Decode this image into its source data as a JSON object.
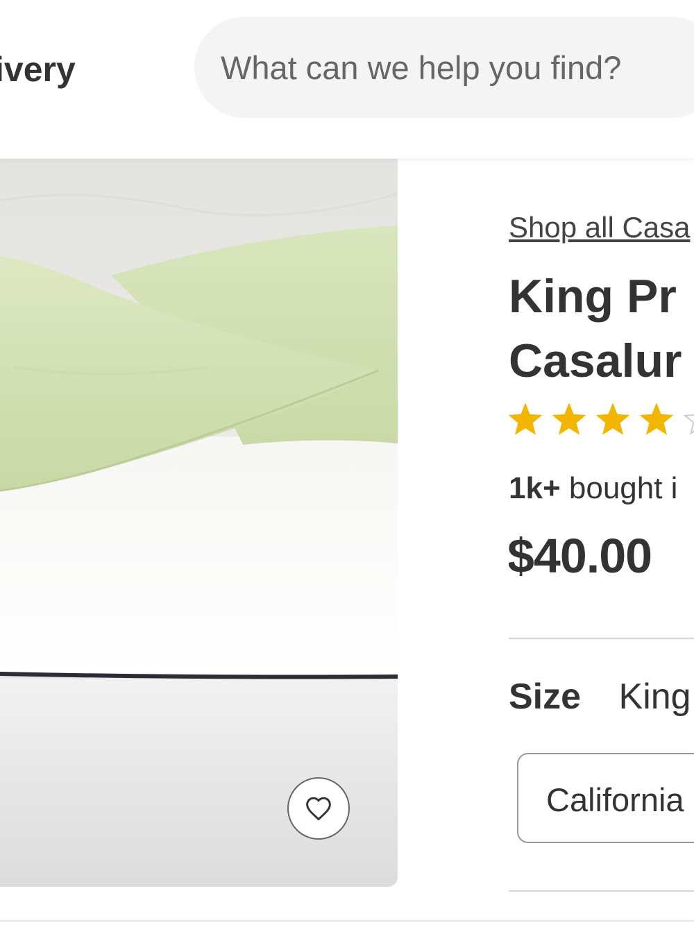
{
  "header": {
    "delivery_label": "ivery",
    "search": {
      "placeholder": "What can we help you find?"
    }
  },
  "product": {
    "image": {
      "description_icon": "pillows-on-bed-image",
      "favorite_icon": "heart-icon"
    },
    "shop_all_link": "Shop all Casa",
    "title_lines": [
      "King Pr",
      "Casalur"
    ],
    "rating": {
      "stars_filled": 4,
      "stars_total": 5,
      "star_color": "#f2b600",
      "empty_star_color": "#cccccc"
    },
    "bought": {
      "count": "1k+",
      "text": "bought i"
    },
    "price": "$40.00",
    "size": {
      "label": "Size",
      "selected_value": "King",
      "options": [
        "California"
      ]
    }
  },
  "colors": {
    "text_primary": "#333333",
    "search_bg": "#f4f4f4",
    "pillow_green": "#d3e2b3"
  }
}
